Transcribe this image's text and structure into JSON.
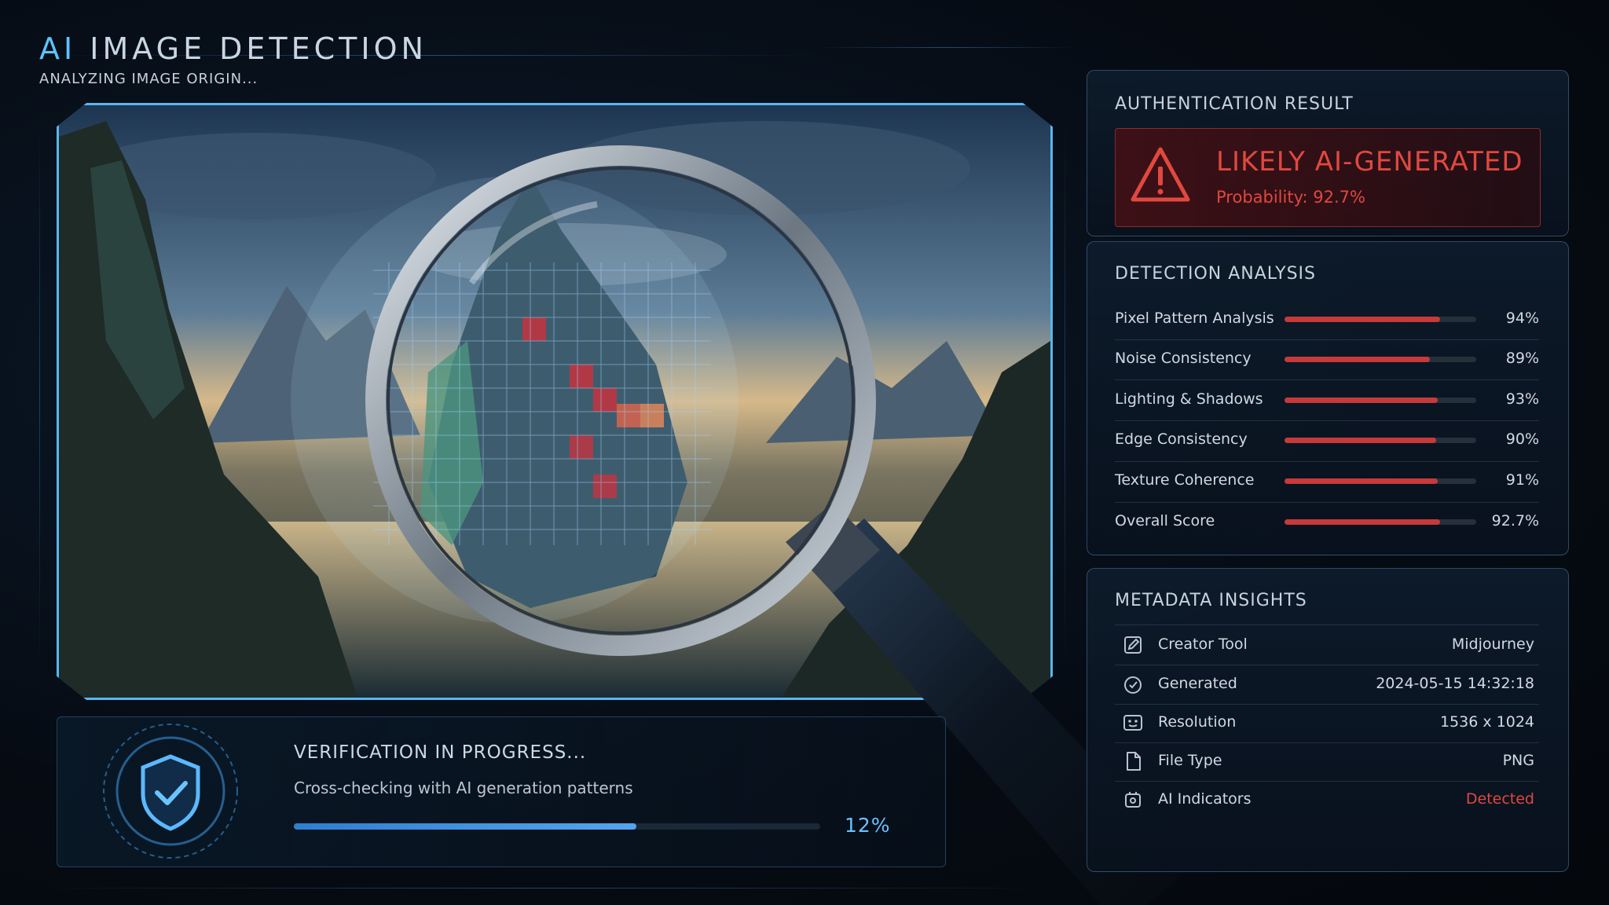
{
  "header": {
    "title_ai": "AI",
    "title_rest": "IMAGE DETECTION",
    "subtitle": "ANALYZING IMAGE ORIGIN..."
  },
  "verification": {
    "title": "VERIFICATION IN PROGRESS...",
    "description": "Cross-checking with AI generation patterns",
    "progress_label": "12%",
    "progress_value": 0.65
  },
  "authentication": {
    "title": "AUTHENTICATION RESULT",
    "result": "LIKELY AI-GENERATED",
    "probability": "Probability: 92.7%"
  },
  "analysis": {
    "title": "DETECTION ANALYSIS",
    "metrics": [
      {
        "label": "Pixel Pattern Analysis",
        "value": "94%",
        "fill": 0.81
      },
      {
        "label": "Noise Consistency",
        "value": "89%",
        "fill": 0.76
      },
      {
        "label": "Lighting & Shadows",
        "value": "93%",
        "fill": 0.8
      },
      {
        "label": "Edge Consistency",
        "value": "90%",
        "fill": 0.79
      },
      {
        "label": "Texture Coherence",
        "value": "91%",
        "fill": 0.8
      },
      {
        "label": "Overall Score",
        "value": "92.7%",
        "fill": 0.81
      }
    ]
  },
  "metadata": {
    "title": "METADATA INSIGHTS",
    "rows": [
      {
        "label": "Creator Tool",
        "value": "Midjourney",
        "icon": "edit-icon"
      },
      {
        "label": "Generated",
        "value": "2024-05-15 14:32:18",
        "icon": "clock-icon"
      },
      {
        "label": "Resolution",
        "value": "1536 x 1024",
        "icon": "resolution-icon"
      },
      {
        "label": "File Type",
        "value": "PNG",
        "icon": "file-icon"
      },
      {
        "label": "AI Indicators",
        "value": "Detected",
        "icon": "ai-chip-icon"
      }
    ]
  },
  "colors": {
    "accent": "#5cc3ff",
    "alert": "#e0483f",
    "bar_fill": "#c8393a",
    "frame_border": "#58b6f2"
  }
}
